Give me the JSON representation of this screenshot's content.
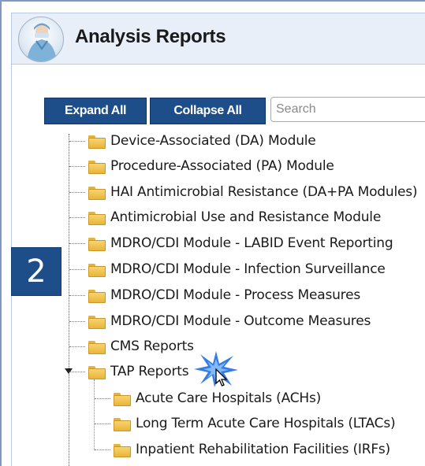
{
  "header": {
    "title": "Analysis Reports",
    "avatar_icon": "nurse-avatar-icon"
  },
  "toolbar": {
    "expand_label": "Expand All",
    "collapse_label": "Collapse All",
    "search_placeholder": "Search"
  },
  "tree": {
    "items": [
      {
        "label": "Device-Associated (DA) Module"
      },
      {
        "label": "Procedure-Associated (PA) Module"
      },
      {
        "label": "HAI Antimicrobial Resistance (DA+PA Modules)"
      },
      {
        "label": "Antimicrobial Use and Resistance Module"
      },
      {
        "label": "MDRO/CDI Module - LABID Event Reporting"
      },
      {
        "label": "MDRO/CDI Module - Infection Surveillance"
      },
      {
        "label": "MDRO/CDI Module - Process Measures"
      },
      {
        "label": "MDRO/CDI Module - Outcome Measures"
      },
      {
        "label": "CMS Reports"
      },
      {
        "label": "TAP Reports",
        "expanded": true
      }
    ],
    "tap_children": [
      {
        "label": "Acute Care Hospitals (ACHs)"
      },
      {
        "label": "Long Term Acute Care Hospitals (LTACs)"
      },
      {
        "label": "Inpatient Rehabilitation Facilities (IRFs)"
      }
    ]
  },
  "step_badge": "2",
  "colors": {
    "button_bg": "#1d4e89",
    "header_bg": "#e8eff8",
    "folder": "#f3c552",
    "burst": "#1f6fe0"
  }
}
